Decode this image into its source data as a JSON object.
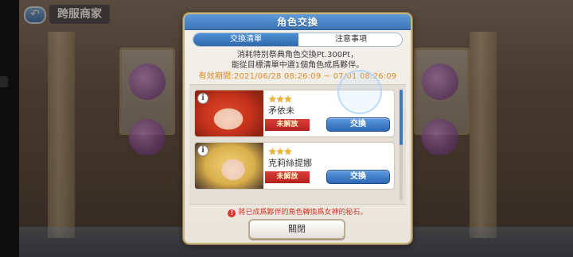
{
  "screen": {
    "title": "跨服商家",
    "back_icon": "undo-arrow-icon"
  },
  "dialog": {
    "title": "角色交換",
    "tabs": [
      {
        "label": "交換清單",
        "active": true
      },
      {
        "label": "注意事項",
        "active": false
      }
    ],
    "description_line1": "消耗特別祭典角色交換Pt.300Pt，",
    "description_line2": "能從目標清單中選1個角色成爲夥伴。",
    "period": "有效期間:2021/06/28 08:26:09 ~ 07/01 08:26:09",
    "characters": [
      {
        "name": "矛依未",
        "stars": "★★★",
        "status": "未解放",
        "action": "交換",
        "info": "i"
      },
      {
        "name": "克莉絲提娜",
        "stars": "★★★",
        "status": "未解放",
        "action": "交換",
        "info": "i"
      }
    ],
    "warning_icon": "!",
    "warning": "將已成爲夥伴的角色轉換爲女神的秘石。",
    "close_label": "關閉"
  },
  "colors": {
    "header_blue": "#3d74b6",
    "period_orange": "#e08a28",
    "status_red": "#c4281f",
    "warning_red": "#d23a2e",
    "star_gold": "#f0b52a"
  }
}
